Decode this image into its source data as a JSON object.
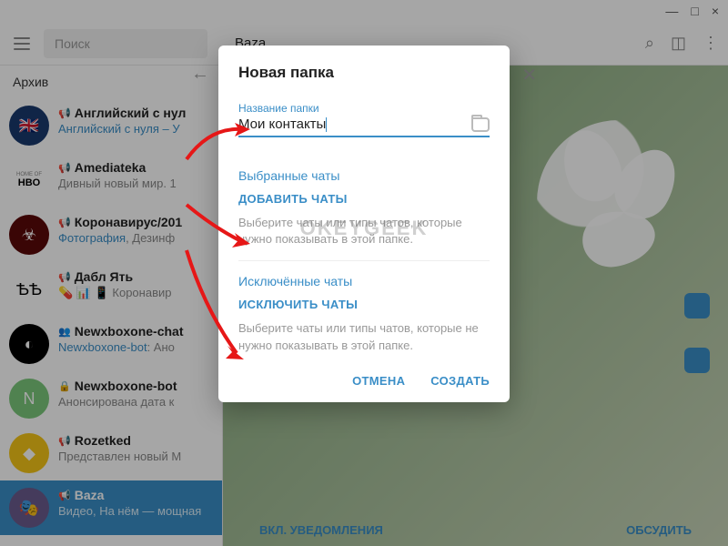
{
  "window": {
    "min": "—",
    "max": "□",
    "close": "×"
  },
  "header": {
    "search_placeholder": "Поиск",
    "chat_title": "Baza"
  },
  "sidebar": {
    "archive": "Архив",
    "chats": [
      {
        "icon": "📢",
        "name": "Английский с нул",
        "sub_prefix": "Английский с нуля – У",
        "sub": "",
        "link": true,
        "ava_bg": "#1a3a6e",
        "ava_txt": "🇬🇧"
      },
      {
        "icon": "📢",
        "name": "Amediateka",
        "sub": "Дивный новый мир. 1",
        "ava_label": "HOME OF",
        "ava_sub": "HBO",
        "ava_bg": "#fff"
      },
      {
        "icon": "📢",
        "name": "Коронавирус/201",
        "sub_prefix": "Фотография",
        "sub": ", Дезинф",
        "link": true,
        "ava_bg": "#5a0808",
        "ava_txt": "☣"
      },
      {
        "icon": "📢",
        "name": "Дабл Ять",
        "sub": "💊 📊 📱 Коронавир",
        "ava_bg": "#fff",
        "ava_txt": "ѢѢ",
        "ava_color": "#000"
      },
      {
        "icon": "👥",
        "name": "Newxboxone-chat",
        "sub_prefix": "Newxboxone-bot",
        "sub": ": Ано",
        "link": true,
        "ava_bg": "#000",
        "ava_txt": "◐"
      },
      {
        "icon": "🔒",
        "name": "Newxboxone-bot",
        "sub": "Анонсирована дата к",
        "ava_bg": "#7bc87b",
        "ava_txt": "N"
      },
      {
        "icon": "📢",
        "name": "Rozetked",
        "sub": "Представлен новый M",
        "ava_bg": "#f5c518",
        "ava_txt": "◆"
      },
      {
        "icon": "📢",
        "name": "Baza",
        "sub": "Видео, На нём — мощная",
        "ava_bg": "#6b5b8e",
        "ava_txt": "🎭",
        "selected": true
      }
    ]
  },
  "content": {
    "notif": "ВКЛ. УВЕДОМЛЕНИЯ",
    "discuss": "ОБСУДИТЬ"
  },
  "dialog": {
    "title": "Новая папка",
    "field_label": "Название папки",
    "field_value": "Мои контакты",
    "sections": [
      {
        "head": "Выбранные чаты",
        "action": "ДОБАВИТЬ ЧАТЫ",
        "hint": "Выберите чаты или типы чатов, которые нужно показывать в этой папке."
      },
      {
        "head": "Исключённые чаты",
        "action": "ИСКЛЮЧИТЬ ЧАТЫ",
        "hint": "Выберите чаты или типы чатов, которые не нужно показывать в этой папке."
      }
    ],
    "cancel": "ОТМЕНА",
    "create": "СОЗДАТЬ"
  },
  "watermark": "OKEYGEEK"
}
